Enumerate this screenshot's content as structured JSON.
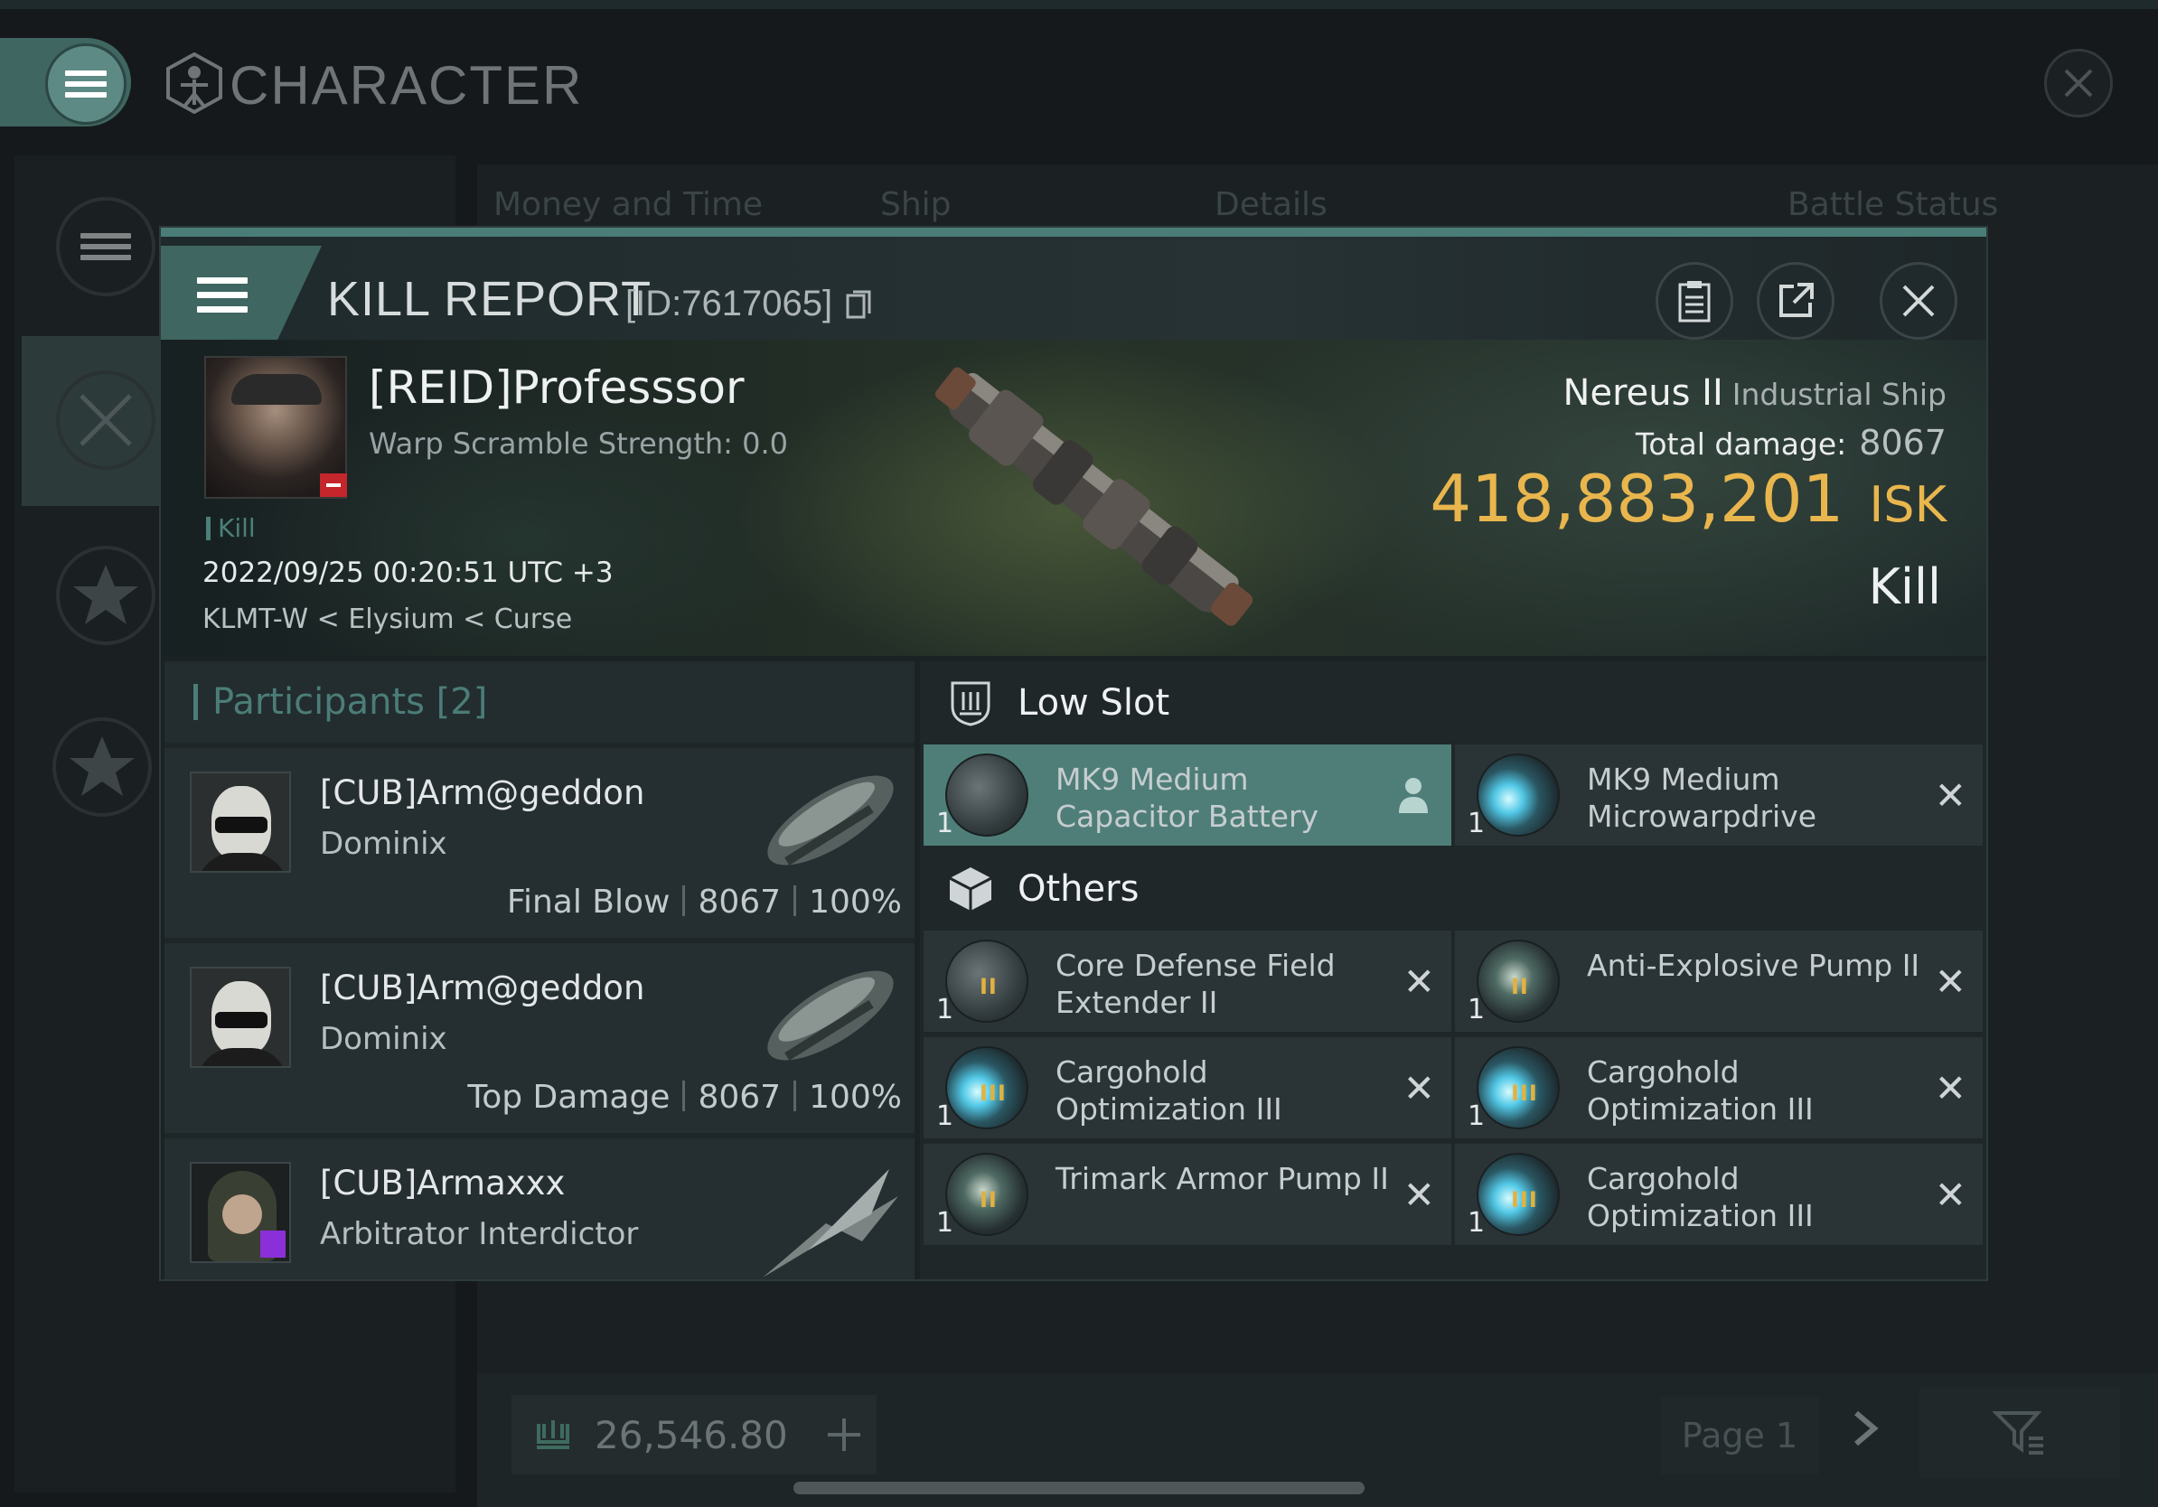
{
  "window": {
    "title": "CHARACTER",
    "bg_tabs": [
      "Money and Time",
      "Ship",
      "Details",
      "Battle Status"
    ]
  },
  "bottom_bar": {
    "wallet_value": "26,546.80",
    "page_label": "Page 1"
  },
  "report": {
    "title": "KILL REPORT",
    "id_label": "[ID:7617065]",
    "victim": {
      "name": "[REID]Professsor",
      "warp_scramble": "Warp Scramble Strength: 0.0",
      "tag": "Kill",
      "time": "2022/09/25 00:20:51 UTC +3",
      "location": "KLMT-W < Elysium < Curse"
    },
    "ship": {
      "name": "Nereus II",
      "class": "Industrial Ship",
      "total_damage_label": "Total damage:",
      "total_damage": "8067",
      "isk_value": "418,883,201",
      "isk_unit": "ISK",
      "result": "Kill"
    }
  },
  "participants": {
    "header": "Participants [2]",
    "rows": [
      {
        "name": "[CUB]Arm@geddon",
        "ship": "Dominix",
        "role": "Final Blow",
        "damage": "8067",
        "percent": "100%"
      },
      {
        "name": "[CUB]Arm@geddon",
        "ship": "Dominix",
        "role": "Top Damage",
        "damage": "8067",
        "percent": "100%"
      },
      {
        "name": "[CUB]Armaxxx",
        "ship": "Arbitrator Interdictor"
      }
    ]
  },
  "fittings": {
    "low_slot_label": "Low Slot",
    "others_label": "Others",
    "low_slot": [
      {
        "qty": "1",
        "name": "MK9 Medium Capacitor Battery",
        "state": "dropped"
      },
      {
        "qty": "1",
        "name": "MK9 Medium Microwarpdrive",
        "state": "destroyed"
      }
    ],
    "others": [
      {
        "qty": "1",
        "name": "Core Defense Field Extender II",
        "tier": "II"
      },
      {
        "qty": "1",
        "name": "Anti-Explosive Pump II",
        "tier": "II"
      },
      {
        "qty": "1",
        "name": "Cargohold Optimization III",
        "tier": "III"
      },
      {
        "qty": "1",
        "name": "Cargohold Optimization III",
        "tier": "III"
      },
      {
        "qty": "1",
        "name": "Trimark Armor Pump II",
        "tier": "II"
      },
      {
        "qty": "1",
        "name": "Cargohold Optimization III",
        "tier": "III"
      }
    ],
    "destroyed_mark": "✕"
  },
  "colors": {
    "accent": "#4f7e79",
    "isk": "#e9b64e",
    "corp_badge": "#c4262c"
  }
}
